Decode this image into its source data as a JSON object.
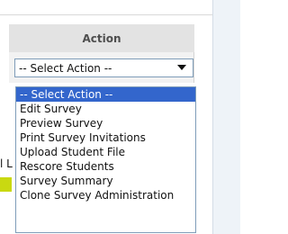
{
  "table": {
    "action_header": "Action"
  },
  "action_select": {
    "selected": "-- Select Action --",
    "options": [
      "-- Select Action --",
      "Edit Survey",
      "Preview Survey",
      "Print Survey Invitations",
      "Upload Student File",
      "Rescore Students",
      "Survey Summary",
      "Clone Survey Administration"
    ]
  },
  "partial_left_text": "l L",
  "colors": {
    "header_background": "#e3e3e3",
    "selected_option": "#3366cc",
    "side_panel": "#eef3f8",
    "accent_chip": "#c9d911"
  },
  "icons": {
    "select_arrow": "chevron-down-icon"
  }
}
